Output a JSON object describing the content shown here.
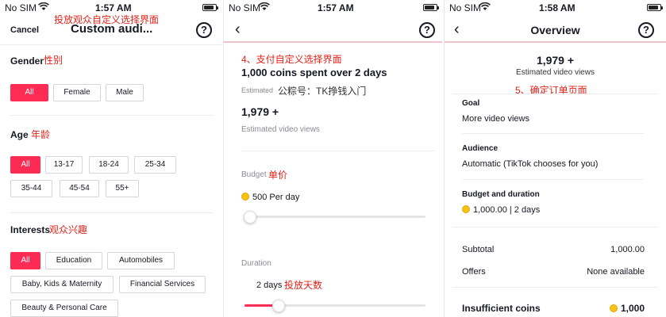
{
  "screen1": {
    "status": {
      "carrier": "No SIM",
      "time": "1:57 AM"
    },
    "nav": {
      "cancel": "Cancel",
      "title": "Custom audi...",
      "help": "?"
    },
    "annotation_top": "投放观众自定义选择界面",
    "gender": {
      "title": "Gender",
      "annotation": "性别",
      "options": [
        "All",
        "Female",
        "Male"
      ],
      "selected": "All"
    },
    "age": {
      "title": "Age",
      "annotation": "年龄",
      "options": [
        "All",
        "13-17",
        "18-24",
        "25-34",
        "35-44",
        "45-54",
        "55+"
      ],
      "selected": "All"
    },
    "interests": {
      "title": "Interests",
      "annotation": "观众兴趣",
      "options": [
        "All",
        "Education",
        "Automobiles",
        "Baby, Kids & Maternity",
        "Financial Services",
        "Beauty & Personal Care"
      ],
      "selected": "All"
    }
  },
  "screen2": {
    "status": {
      "carrier": "No SIM",
      "time": "1:57 AM"
    },
    "nav": {
      "back": "‹",
      "help": "?"
    },
    "annotation_top": "4、支付自定义选择界面",
    "headline": "1,000 coins spent over 2 days",
    "estimated_label_partial": "Estimated",
    "estimated_label_partial_end": "st",
    "watermark": "公粽号：TK挣钱入门",
    "views_value": "1,979 +",
    "views_label": "Estimated video views",
    "budget": {
      "title": "Budget",
      "annotation": "单价",
      "value": "500 Per day",
      "level": 0.03
    },
    "duration": {
      "title": "Duration",
      "value": "2 days",
      "annotation": "投放天数",
      "level": 0.19
    }
  },
  "screen3": {
    "status": {
      "carrier": "No SIM",
      "time": "1:58 AM"
    },
    "nav": {
      "back": "‹",
      "title": "Overview",
      "help": "?"
    },
    "views_value": "1,979 +",
    "views_label": "Estimated video views",
    "annotation": "5、确定订单页面",
    "goal": {
      "title": "Goal",
      "value": "More video views"
    },
    "audience": {
      "title": "Audience",
      "value": "Automatic (TikTok chooses for you)"
    },
    "budget_duration": {
      "title": "Budget and duration",
      "value": "1,000.00 | 2 days"
    },
    "subtotal": {
      "label": "Subtotal",
      "value": "1,000.00"
    },
    "offers": {
      "label": "Offers",
      "value": "None available"
    },
    "insufficient": {
      "label": "Insufficient coins",
      "value": "1,000"
    }
  },
  "colors": {
    "accent": "#fe2c55",
    "annotation": "#e2231a",
    "coin": "#f7c21a"
  },
  "icons": [
    "wifi-icon",
    "battery-icon",
    "help-icon",
    "back-icon",
    "coin-icon"
  ]
}
